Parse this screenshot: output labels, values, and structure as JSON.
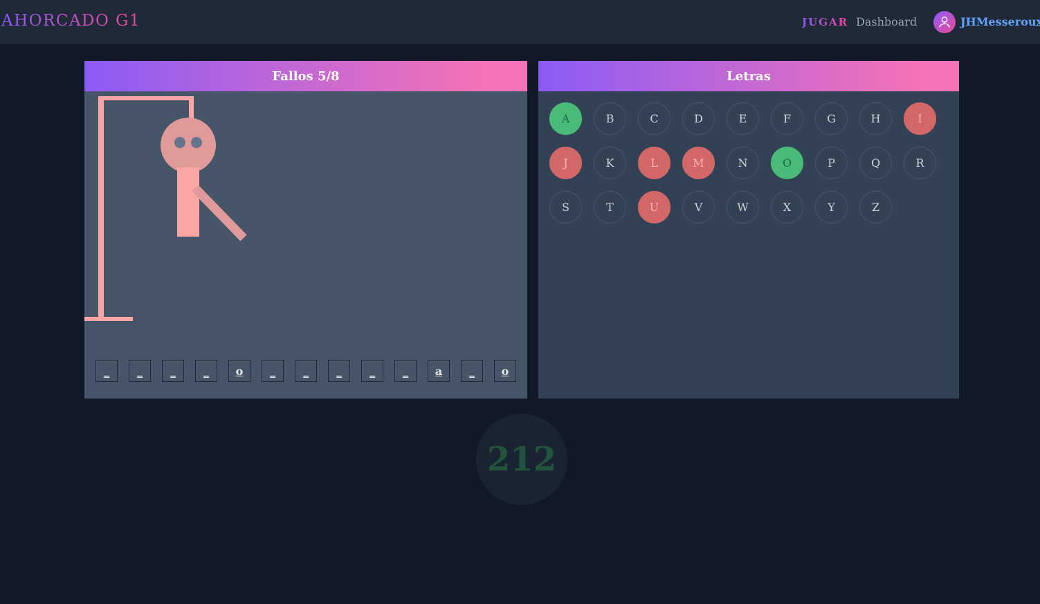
{
  "header": {
    "brand": "AHORCADO G1",
    "nav_play": "JUGAR",
    "nav_dashboard": "Dashboard",
    "username": "JHMesseroux"
  },
  "game": {
    "fails_label": "Fallos 5/8",
    "fails": 5,
    "max_fails": 8,
    "word_slots": [
      "_",
      "_",
      "_",
      "_",
      "o",
      "_",
      "_",
      "_",
      "_",
      "_",
      "a",
      "_",
      "o"
    ]
  },
  "letters": {
    "title": "Letras",
    "items": [
      {
        "letter": "A",
        "state": "correct"
      },
      {
        "letter": "B",
        "state": "unused"
      },
      {
        "letter": "C",
        "state": "unused"
      },
      {
        "letter": "D",
        "state": "unused"
      },
      {
        "letter": "E",
        "state": "unused"
      },
      {
        "letter": "F",
        "state": "unused"
      },
      {
        "letter": "G",
        "state": "unused"
      },
      {
        "letter": "H",
        "state": "unused"
      },
      {
        "letter": "I",
        "state": "wrong"
      },
      {
        "letter": "J",
        "state": "wrong"
      },
      {
        "letter": "K",
        "state": "unused"
      },
      {
        "letter": "L",
        "state": "wrong"
      },
      {
        "letter": "M",
        "state": "wrong"
      },
      {
        "letter": "N",
        "state": "unused"
      },
      {
        "letter": "O",
        "state": "correct"
      },
      {
        "letter": "P",
        "state": "unused"
      },
      {
        "letter": "Q",
        "state": "unused"
      },
      {
        "letter": "R",
        "state": "unused"
      },
      {
        "letter": "S",
        "state": "unused"
      },
      {
        "letter": "T",
        "state": "unused"
      },
      {
        "letter": "U",
        "state": "wrong"
      },
      {
        "letter": "V",
        "state": "unused"
      },
      {
        "letter": "W",
        "state": "unused"
      },
      {
        "letter": "X",
        "state": "unused"
      },
      {
        "letter": "Y",
        "state": "unused"
      },
      {
        "letter": "Z",
        "state": "unused"
      }
    ]
  },
  "score": "212",
  "colors": {
    "accent_start": "#8b5cf6",
    "accent_end": "#f472b6",
    "correct": "#48bb78",
    "wrong": "#d36666",
    "gallows": "#fca5a5"
  }
}
